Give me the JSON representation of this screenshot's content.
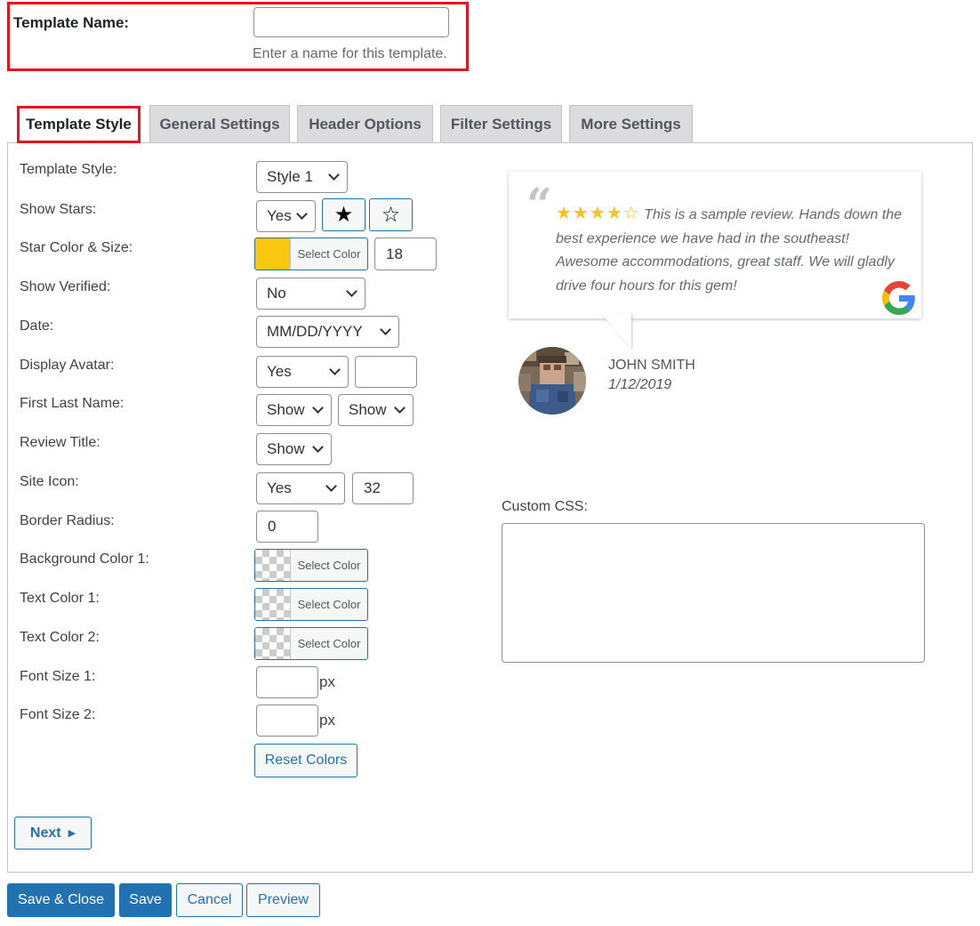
{
  "template_name": {
    "label": "Template Name:",
    "value": "",
    "help": "Enter a name for this template."
  },
  "tabs": [
    {
      "label": "Template Style"
    },
    {
      "label": "General Settings"
    },
    {
      "label": "Header Options"
    },
    {
      "label": "Filter Settings"
    },
    {
      "label": "More Settings"
    }
  ],
  "fields": {
    "template_style": {
      "label": "Template Style:",
      "value": "Style 1"
    },
    "show_stars": {
      "label": "Show Stars:",
      "value": "Yes"
    },
    "star_color_size": {
      "label": "Star Color & Size:",
      "color_btn": "Select Color",
      "size": "18",
      "color": "#f9c80e"
    },
    "show_verified": {
      "label": "Show Verified:",
      "value": "No"
    },
    "date": {
      "label": "Date:",
      "value": "MM/DD/YYYY"
    },
    "display_avatar": {
      "label": "Display Avatar:",
      "value": "Yes",
      "extra": ""
    },
    "first_last_name": {
      "label": "First Last Name:",
      "first": "Show",
      "last": "Show"
    },
    "review_title": {
      "label": "Review Title:",
      "value": "Show"
    },
    "site_icon": {
      "label": "Site Icon:",
      "value": "Yes",
      "size": "32"
    },
    "border_radius": {
      "label": "Border Radius:",
      "value": "0"
    },
    "bg_color_1": {
      "label": "Background Color 1:",
      "color_btn": "Select Color"
    },
    "text_color_1": {
      "label": "Text Color 1:",
      "color_btn": "Select Color"
    },
    "text_color_2": {
      "label": "Text Color 2:",
      "color_btn": "Select Color"
    },
    "font_size_1": {
      "label": "Font Size 1:",
      "value": "",
      "unit": "px"
    },
    "font_size_2": {
      "label": "Font Size 2:",
      "value": "",
      "unit": "px"
    },
    "reset_colors": "Reset Colors"
  },
  "preview": {
    "stars": "★★★★☆",
    "text": "This is a sample review. Hands down the best experience we have had in the southeast! Awesome accommodations, great staff. We will gladly drive four hours for this gem!",
    "name": "JOHN SMITH",
    "date": "1/12/2019",
    "site_icon": "google-icon"
  },
  "custom_css": {
    "label": "Custom CSS:",
    "value": ""
  },
  "buttons": {
    "next": "Next",
    "save_close": "Save & Close",
    "save": "Save",
    "cancel": "Cancel",
    "preview": "Preview"
  },
  "colors": {
    "primary": "#2271b1",
    "highlight": "#e8141b",
    "star": "#f5c518"
  }
}
